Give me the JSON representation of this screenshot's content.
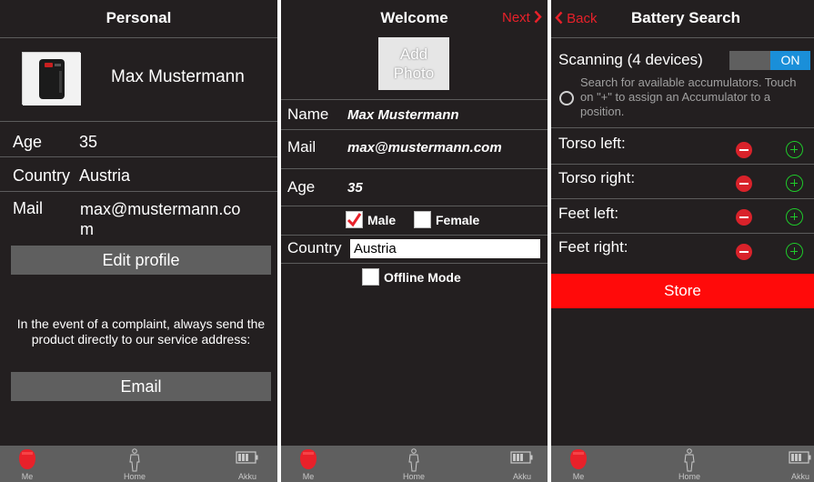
{
  "colors": {
    "accent_red": "#e8212a",
    "store_red": "#ff0a0a",
    "toggle_blue": "#1a8fd9",
    "plus_green": "#1fc92a",
    "background": "#231f20",
    "gray": "#5f5f5f"
  },
  "tabbar": {
    "tabs": [
      {
        "label": "Me",
        "icon": "me-icon"
      },
      {
        "label": "Home",
        "icon": "person-icon"
      },
      {
        "label": "Akku",
        "icon": "battery-icon"
      }
    ]
  },
  "personal": {
    "title": "Personal",
    "name": "Max Mustermann",
    "age_label": "Age",
    "age_value": "35",
    "country_label": "Country",
    "country_value": "Austria",
    "mail_label": "Mail",
    "mail_value_line1": "max@mustermann.co",
    "mail_value_line2": "m",
    "edit_button": "Edit profile",
    "note": "In the event of a complaint, always send the product directly to our service address:",
    "email_button": "Email"
  },
  "welcome": {
    "title": "Welcome",
    "next_label": "Next",
    "add_photo": "Add Photo",
    "name_label": "Name",
    "name_value": "Max Mustermann",
    "mail_label": "Mail",
    "mail_value": "max@mustermann.com",
    "age_label": "Age",
    "age_value": "35",
    "male_label": "Male",
    "male_checked": true,
    "female_label": "Female",
    "female_checked": false,
    "country_label": "Country",
    "country_value": "Austria",
    "offline_label": "Offline Mode",
    "offline_checked": false
  },
  "battery": {
    "back_label": "Back",
    "title": "Battery Search",
    "scanning_label": "Scanning (4 devices)",
    "toggle_value": "ON",
    "hint": "Search for available accumulators. Touch on \"+\" to assign an Accumulator to a position.",
    "slots": [
      "Torso left:",
      "Torso right:",
      "Feet left:",
      "Feet right:"
    ],
    "store_button": "Store"
  }
}
